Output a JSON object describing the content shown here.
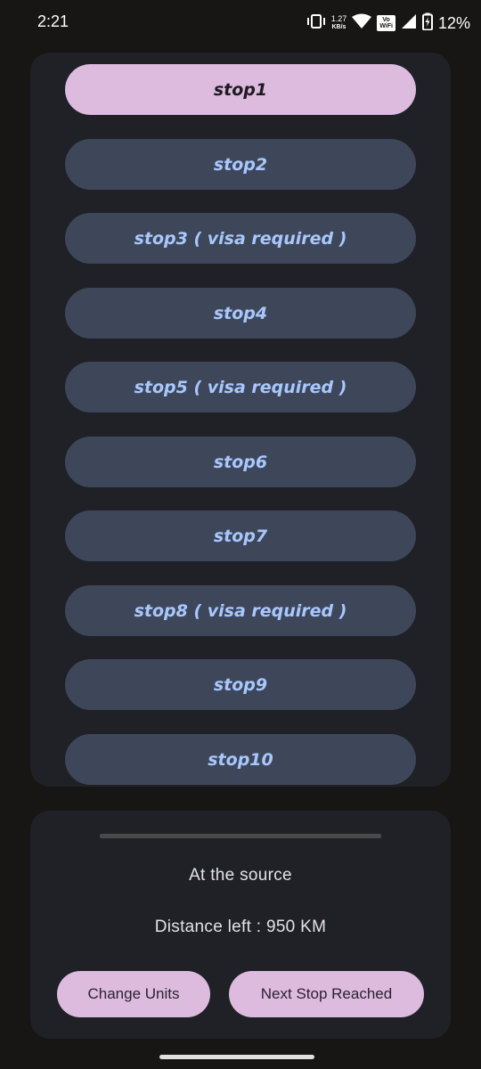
{
  "status_bar": {
    "time": "2:21",
    "net_speed_value": "1.27",
    "net_speed_unit": "KB/s",
    "vowifi_top": "Vo",
    "vowifi_bottom": "WiFi",
    "battery_percent": "12%"
  },
  "stops": [
    {
      "label": "stop1",
      "active": true
    },
    {
      "label": "stop2",
      "active": false
    },
    {
      "label": "stop3 ( visa required )",
      "active": false
    },
    {
      "label": "stop4",
      "active": false
    },
    {
      "label": "stop5 ( visa required )",
      "active": false
    },
    {
      "label": "stop6",
      "active": false
    },
    {
      "label": "stop7",
      "active": false
    },
    {
      "label": "stop8 ( visa required )",
      "active": false
    },
    {
      "label": "stop9",
      "active": false
    },
    {
      "label": "stop10",
      "active": false
    }
  ],
  "sheet": {
    "status_text": "At the source",
    "distance_text": "Distance left : 950 KM",
    "change_units_label": "Change Units",
    "next_stop_label": "Next Stop Reached"
  },
  "colors": {
    "background": "#181614",
    "card": "#1f2126",
    "stop_button": "#3e4759",
    "stop_text": "#a9c7ff",
    "accent_pill": "#ddbbdf"
  }
}
